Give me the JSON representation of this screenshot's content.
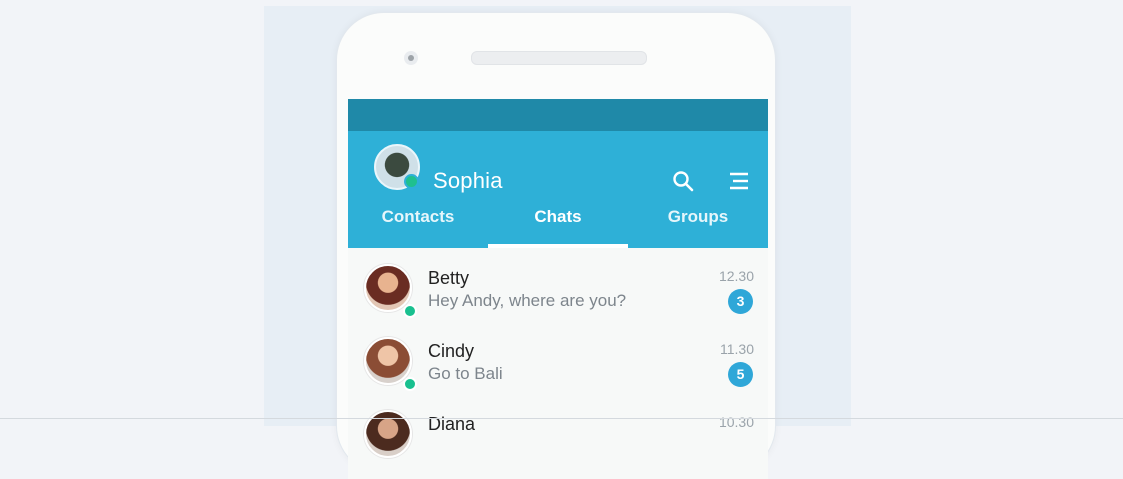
{
  "app": {
    "user_name": "Sophia",
    "tabs": [
      {
        "label": "Contacts",
        "active": false
      },
      {
        "label": "Chats",
        "active": true
      },
      {
        "label": "Groups",
        "active": false
      }
    ],
    "icons": {
      "search": "search-icon",
      "menu": "menu-icon",
      "camera": "camera-icon"
    },
    "colors": {
      "status_bar": "#1f89a8",
      "app_bar": "#2eb0d7",
      "badge": "#2fa7d8",
      "online": "#1fc08e"
    }
  },
  "chats": [
    {
      "name": "Betty",
      "message": "Hey Andy, where are you?",
      "time": "12.30",
      "unread": "3",
      "online": true
    },
    {
      "name": "Cindy",
      "message": "Go to Bali",
      "time": "11.30",
      "unread": "5",
      "online": true
    },
    {
      "name": "Diana",
      "message": "",
      "time": "10.30",
      "unread": "",
      "online": false
    }
  ]
}
